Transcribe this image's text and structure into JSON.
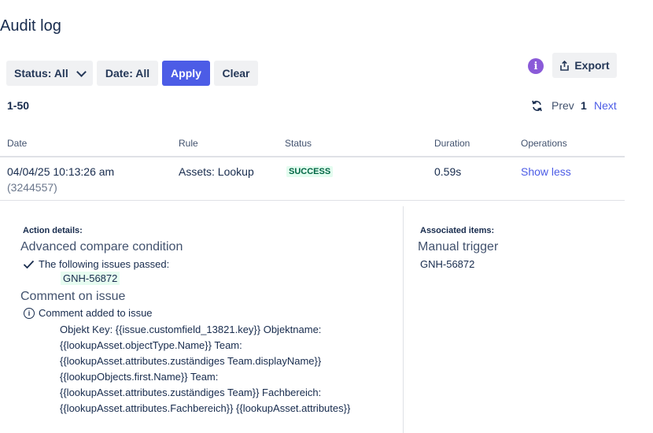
{
  "page": {
    "title": "Audit log"
  },
  "filters": {
    "status_label": "Status: All",
    "date_label": "Date: All",
    "apply_label": "Apply",
    "clear_label": "Clear"
  },
  "toolbar": {
    "info_icon": "i",
    "export_label": "Export"
  },
  "pagination": {
    "range": "1-50",
    "prev": "Prev",
    "current": "1",
    "next": "Next"
  },
  "table": {
    "headers": [
      "Date",
      "Rule",
      "Status",
      "Duration",
      "Operations"
    ],
    "rows": [
      {
        "date": "04/04/25 10:13:26 am",
        "id": "(3244557)",
        "rule": "Assets: Lookup",
        "status": "SUCCESS",
        "duration": "0.59s",
        "operation": "Show less"
      }
    ]
  },
  "details": {
    "action_heading": "Action details:",
    "condition_title": "Advanced compare condition",
    "condition_result": "The following issues passed:",
    "condition_issue": "GNH-56872",
    "comment_title": "Comment on issue",
    "comment_result": "Comment added to issue",
    "comment_body": "Objekt Key: {{issue.customfield_13821.key}} Objektname:\n{{lookupAsset.objectType.Name}} Team:\n{{lookupAsset.attributes.zuständiges Team.displayName}}\n{{lookupObjects.first.Name}} Team:\n{{lookupAsset.attributes.zuständiges Team}} Fachbereich:\n{{lookupAsset.attributes.Fachbereich}} {{lookupAsset.attributes}}",
    "associated_heading": "Associated items:",
    "trigger_title": "Manual trigger",
    "trigger_issue": "GNH-56872"
  },
  "colors": {
    "accent": "#4c5ce6",
    "success_bg": "#e3fcef",
    "success_text": "#006644",
    "info_badge": "#8a5ad8"
  }
}
